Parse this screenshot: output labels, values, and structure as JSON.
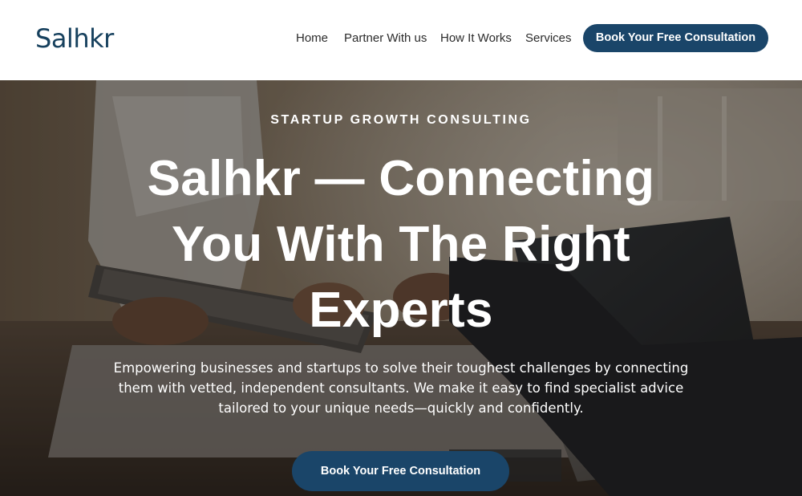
{
  "brand": {
    "logo_text": "Salhkr"
  },
  "nav": {
    "items": [
      {
        "label": "Home"
      },
      {
        "label": "Partner With us"
      },
      {
        "label": "How It Works"
      },
      {
        "label": "Services"
      }
    ],
    "cta_label": "Book Your Free Consultation"
  },
  "hero": {
    "eyebrow": "STARTUP GROWTH CONSULTING",
    "title": "Salhkr — Connecting You With The Right Experts",
    "description": "Empowering businesses and startups to solve their toughest challenges by connecting them with vetted, independent consultants. We make it easy to find specialist advice tailored to your unique needs—quickly and confidently.",
    "cta_label": "Book Your Free Consultation"
  },
  "colors": {
    "brand_navy": "#1a4569",
    "logo_color": "#17415e",
    "nav_text": "#2b2b2b",
    "hero_text": "#ffffff"
  }
}
